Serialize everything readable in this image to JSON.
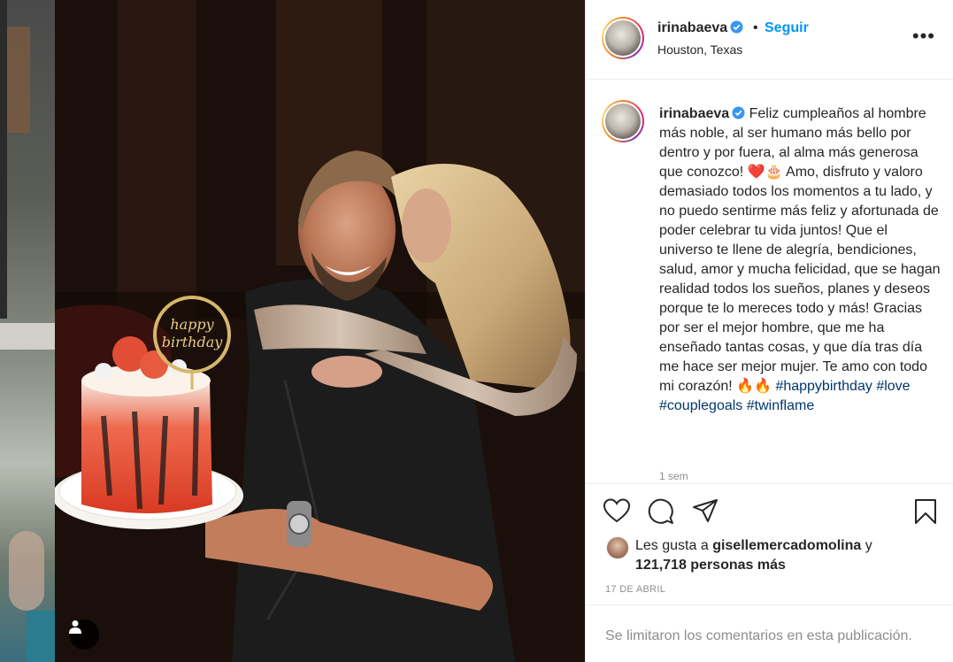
{
  "post": {
    "username": "irinabaeva",
    "follow_label": "Seguir",
    "separator": "•",
    "location": "Houston, Texas",
    "more_label": "•••",
    "caption_parts": {
      "text1": "Feliz cumpleaños al hombre más noble, al ser humano más bello por dentro y por fuera, al alma más generosa que conozco! ❤️🎂 Amo, disfruto y valoro demasiado todos los momentos a tu lado, y no puedo sentirme más feliz y afortunada de poder celebrar tu vida juntos! Que el universo te llene de alegría, bendiciones, salud, amor y mucha felicidad, que se hagan realidad todos los sueños, planes y deseos porque te lo mereces todo y más! Gracias por ser el mejor hombre, que me ha enseñado tantas cosas, y que día tras día me hace ser mejor mujer. Te amo con todo mi corazón! 🔥🔥 ",
      "hashtags": [
        "#happybirthday",
        "#love",
        "#couplegoals",
        "#twinflame"
      ]
    },
    "time_ago": "1 sem",
    "likes": {
      "prefix": "Les gusta a",
      "liker": "gisellemercadomolina",
      "conj": "y",
      "count_text": "121,718 personas más"
    },
    "date": "17 DE ABRIL",
    "comments_disabled": "Se limitaron los comentarios en esta publicación.",
    "photo": {
      "cake_topper_text": "happy birthday"
    },
    "icons": [
      "heart-icon",
      "comment-icon",
      "share-icon",
      "bookmark-icon",
      "user-tag-icon",
      "verified-icon"
    ],
    "colors": {
      "accent": "#0095f6",
      "hashtag": "#00376b",
      "muted": "#8e8e8e"
    }
  }
}
